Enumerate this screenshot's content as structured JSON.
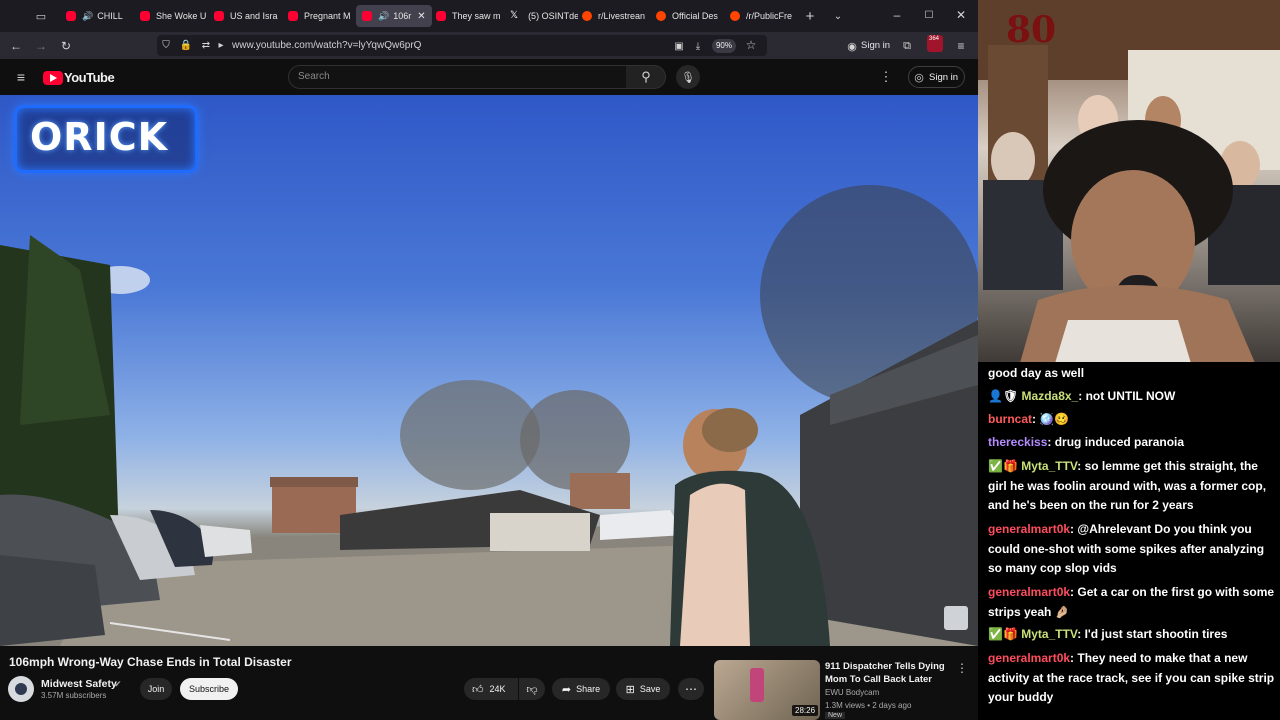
{
  "browser": {
    "tabs": [
      {
        "label": "CHILL",
        "kind": "yt",
        "audio": true
      },
      {
        "label": "She Woke U",
        "kind": "yt"
      },
      {
        "label": "US and Isra",
        "kind": "yt"
      },
      {
        "label": "Pregnant M",
        "kind": "yt"
      },
      {
        "label": "106r",
        "kind": "yt",
        "audio": true,
        "active": true
      },
      {
        "label": "They saw m",
        "kind": "yt"
      },
      {
        "label": "(5) OSINTde",
        "kind": "x"
      },
      {
        "label": "r/Livestrean",
        "kind": "rd"
      },
      {
        "label": "Official Des",
        "kind": "rd"
      },
      {
        "label": "/r/PublicFre",
        "kind": "rd"
      }
    ],
    "url": "www.youtube.com/watch?v=lyYqwQw6prQ",
    "zoom": "90%",
    "sign_in": "Sign in",
    "ext_badge": "364"
  },
  "youtube": {
    "logo_text": "YouTube",
    "search_placeholder": "Search",
    "sign_in": "Sign in"
  },
  "video": {
    "overlay_text": "ORICK",
    "title": "106mph Wrong-Way Chase Ends in Total Disaster",
    "channel": "Midwest Safety",
    "subscribers": "3.57M subscribers",
    "join": "Join",
    "subscribe": "Subscribe",
    "likes": "24K",
    "share": "Share",
    "save": "Save"
  },
  "recommended": {
    "title_line1": "911 Dispatcher Tells Dying",
    "title_line2": "Mom To Call Back Later",
    "channel": "EWU Bodycam",
    "meta": "1.3M views • 2 days ago",
    "badge": "New",
    "duration": "28:26"
  },
  "chat": {
    "partial": "good day as well",
    "messages": [
      {
        "user": "Mazda8x_",
        "color": "#c8e07a",
        "text": ": not UNTIL NOW",
        "badges": "👤🛡"
      },
      {
        "user": "burncat",
        "color": "#ff5a5a",
        "text": ": 🪩🥴"
      },
      {
        "user": "thereckiss",
        "color": "#b48cff",
        "text": ": drug induced paranoia"
      },
      {
        "user": "Myta_TTV",
        "color": "#c8e07a",
        "text": ": so lemme get this straight, the girl he was foolin around with, was a former cop, and he's been on the run for 2 years",
        "badges": "✅🎁"
      },
      {
        "user": "generalmart0k",
        "color": "#ff4d5e",
        "text": ": @Ahrelevant Do you think you could one-shot with some spikes after analyzing so many cop slop vids"
      },
      {
        "user": "generalmart0k",
        "color": "#ff4d5e",
        "text": ": Get a car on the first go with some strips yeah 🤌🏼"
      },
      {
        "user": "Myta_TTV",
        "color": "#c8e07a",
        "text": ": I'd just start shootin tires",
        "badges": "✅🎁"
      },
      {
        "user": "generalmart0k",
        "color": "#ff4d5e",
        "text": ": They need to make that a new activity at the race track, see if you can spike strip your buddy"
      }
    ]
  },
  "colors": {
    "accent": "#ff0033",
    "ui_bg": "#0f0f0f",
    "chrome": "#2b2a33"
  }
}
